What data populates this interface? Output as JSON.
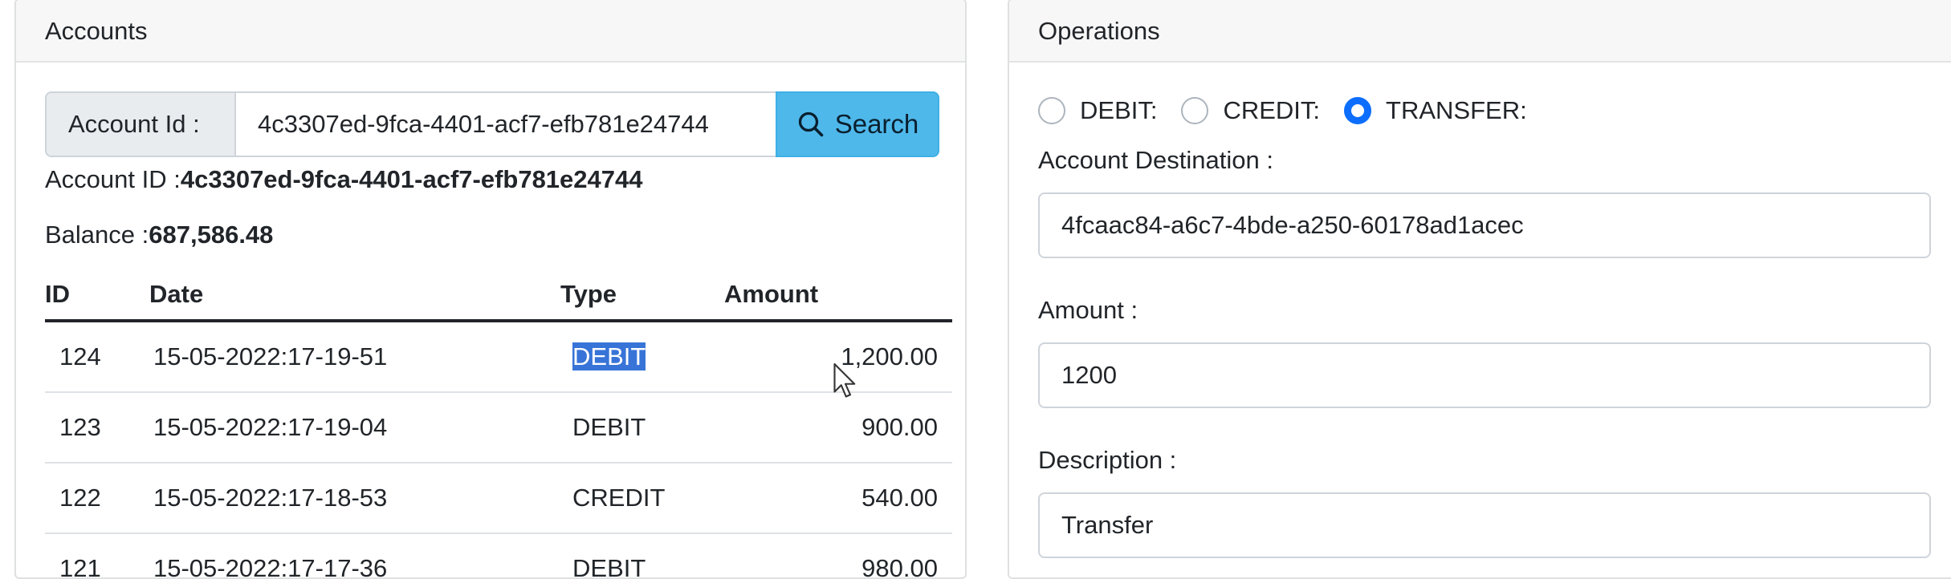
{
  "accounts": {
    "header": "Accounts",
    "search": {
      "addon_label": "Account Id :",
      "value": "4c3307ed-9fca-4401-acf7-efb781e24744",
      "button_label": "Search"
    },
    "account_id_label": "Account ID :",
    "account_id_value": "4c3307ed-9fca-4401-acf7-efb781e24744",
    "balance_label": "Balance :",
    "balance_value": "687,586.48",
    "table": {
      "headers": [
        "ID",
        "Date",
        "Type",
        "Amount"
      ],
      "rows": [
        {
          "id": "124",
          "date": "15-05-2022:17-19-51",
          "type": "DEBIT",
          "amount": "1,200.00"
        },
        {
          "id": "123",
          "date": "15-05-2022:17-19-04",
          "type": "DEBIT",
          "amount": "900.00"
        },
        {
          "id": "122",
          "date": "15-05-2022:17-18-53",
          "type": "CREDIT",
          "amount": "540.00"
        },
        {
          "id": "121",
          "date": "15-05-2022:17-17-36",
          "type": "DEBIT",
          "amount": "980.00"
        }
      ]
    }
  },
  "operations": {
    "header": "Operations",
    "radios": [
      {
        "label": "DEBIT:",
        "checked": false
      },
      {
        "label": "CREDIT:",
        "checked": false
      },
      {
        "label": "TRANSFER:",
        "checked": true
      }
    ],
    "destination_label": "Account Destination :",
    "destination_value": "4fcaac84-a6c7-4bde-a250-60178ad1acec",
    "amount_label": "Amount :",
    "amount_value": "1200",
    "description_label": "Description :",
    "description_value": "Transfer"
  },
  "colors": {
    "search_button": "#4eb8ea",
    "radio_checked": "#0d6efd",
    "selection": "#3874d8"
  }
}
